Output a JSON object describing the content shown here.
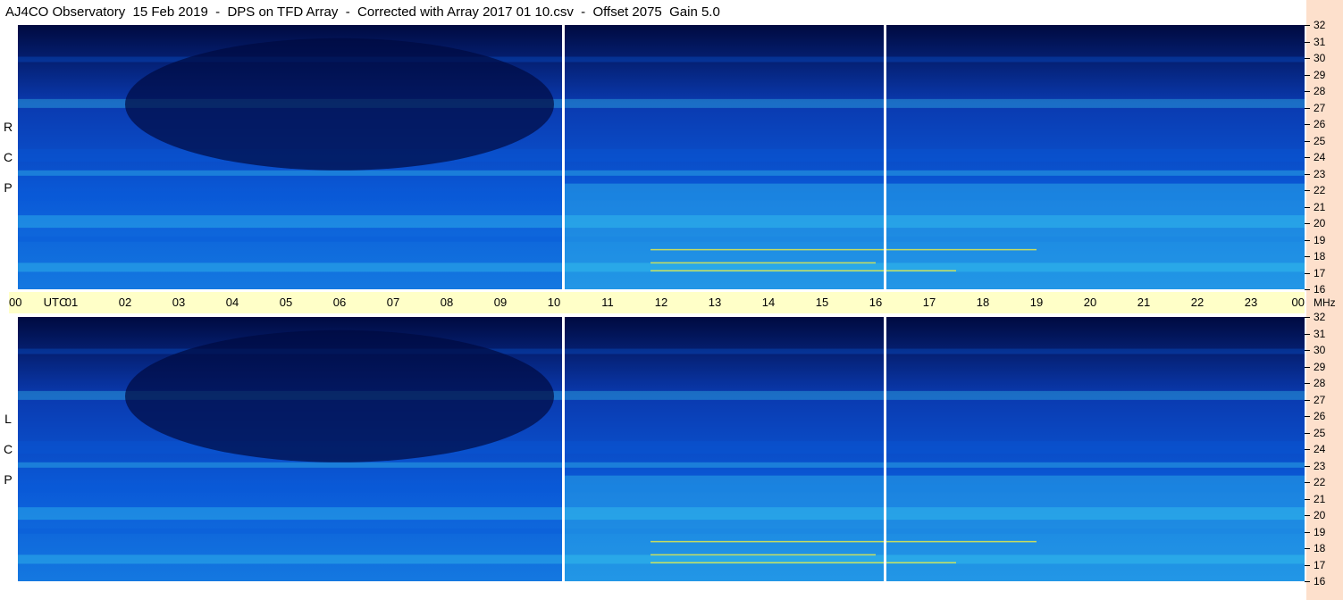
{
  "title": "AJ4CO Observatory  15 Feb 2019  -  DPS on TFD Array  -  Corrected with Array 2017 01 10.csv  -  Offset 2075  Gain 5.0",
  "panels": [
    {
      "label": [
        "R",
        "C",
        "P"
      ]
    },
    {
      "label": [
        "L",
        "C",
        "P"
      ]
    }
  ],
  "chart_data": {
    "type": "heatmap",
    "title": "AJ4CO Observatory  15 Feb 2019  -  DPS on TFD Array  -  Corrected with Array 2017 01 10.csv  -  Offset 2075  Gain 5.0",
    "x_unit": "UTC",
    "y_unit": "MHz",
    "x_ticks": [
      "00",
      "01",
      "02",
      "03",
      "04",
      "05",
      "06",
      "07",
      "08",
      "09",
      "10",
      "11",
      "12",
      "13",
      "14",
      "15",
      "16",
      "17",
      "18",
      "19",
      "20",
      "21",
      "22",
      "23",
      "00"
    ],
    "x_range_hours": [
      0,
      24
    ],
    "y_ticks": [
      "16",
      "17",
      "18",
      "19",
      "20",
      "21",
      "22",
      "23",
      "24",
      "25",
      "26",
      "27",
      "28",
      "29",
      "30",
      "31",
      "32"
    ],
    "y_range_mhz": [
      16,
      32
    ],
    "gap_markers_utc": [
      10.15,
      16.15
    ],
    "panels": [
      "RCP",
      "LCP"
    ],
    "colors": {
      "low": "#000a40",
      "mid": "#0a5ad8",
      "high": "#3cd0f0",
      "peak": "#f0f040"
    }
  }
}
